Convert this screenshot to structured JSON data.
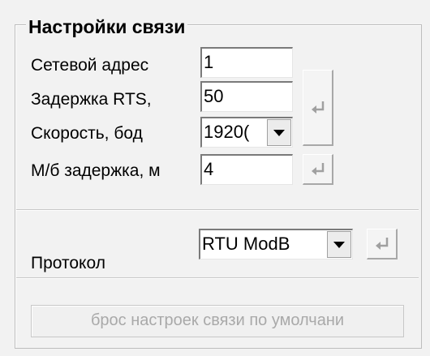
{
  "group": {
    "title": "Настройки связи"
  },
  "network_address": {
    "label": "Сетевой адрес",
    "value": "1"
  },
  "rts_delay": {
    "label": "Задержка RTS,",
    "value": "50"
  },
  "baud_rate": {
    "label": "Скорость, бод",
    "value": "1920("
  },
  "interbyte_delay": {
    "label": "М/б задержка, м",
    "value": "4"
  },
  "protocol": {
    "label": "Протокол",
    "value": "RTU ModB"
  },
  "reset_button": {
    "label": "брос настроек связи по умолчани"
  },
  "icons": {
    "enter": "enter-icon",
    "dropdown": "chevron-down-icon"
  },
  "colors": {
    "background": "#f2f2f2",
    "disabled_text": "#a9a9a9",
    "enter_icon": "#9c9c9c"
  }
}
